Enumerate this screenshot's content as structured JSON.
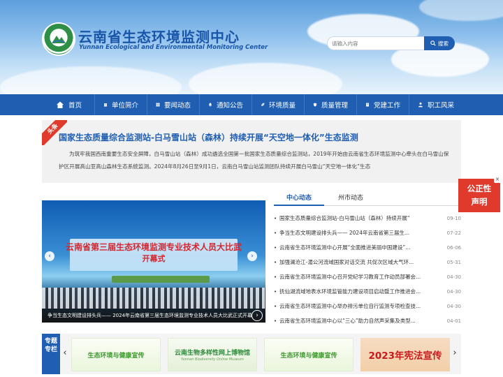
{
  "header": {
    "site_title": "云南省生态环境监测中心",
    "site_subtitle": "Yunnan Ecological and Environmental Monitoring Center",
    "logo_icon": "emblem-icon",
    "search": {
      "placeholder": "请输入内容",
      "button_label": "搜索",
      "button_icon": "search-icon"
    }
  },
  "nav": {
    "items": [
      {
        "label": "首页",
        "icon": "home-icon"
      },
      {
        "label": "单位简介",
        "icon": "building-icon"
      },
      {
        "label": "要闻动态",
        "icon": "grid-icon"
      },
      {
        "label": "通知公告",
        "icon": "bell-icon"
      },
      {
        "label": "环境质量",
        "icon": "leaf-icon"
      },
      {
        "label": "质量管理",
        "icon": "shield-icon"
      },
      {
        "label": "党建工作",
        "icon": "book-icon"
      },
      {
        "label": "职工风采",
        "icon": "people-icon"
      }
    ]
  },
  "headline": {
    "ribbon": "头条",
    "title": "国家生态质量综合监测站-白马雪山站（森林）持续开展“天空地一体化”生态监测",
    "summary": "为筑牢我国西南重要生态安全屏障，白马雪山站（森林）成功遴选全国第一批国家生态质量综合监测站，2019年开始由云南省生态环境监测中心牵头在白马雪山保护区开展高山亚高山森林生态系统监测。2024年8月26日至9月1日，云南白马雪山站监测团队持续开展白马雪山“天空地一体化”生态"
  },
  "slider": {
    "stage_title": "云南省第三届生态环境监测专业技术人员大比武",
    "stage_subtitle": "开幕式",
    "caption": "争当生态文明建设排头兵—— 2024年云南省第三届生态环境监测专业技术人员大比武正式开幕",
    "prev_icon": "chevron-left-icon",
    "next_icon": "chevron-right-icon",
    "play_icon": "play-icon"
  },
  "news": {
    "tabs": [
      "中心动态",
      "州市动态"
    ],
    "active_tab": "中心动态",
    "items": [
      {
        "title": "国家生态质量综合监测站-白马雪山站（森林）持续开展“",
        "date": "09-10"
      },
      {
        "title": "争当生态文明建设排头兵—— 2024年云南省第三届生...",
        "date": "07-22"
      },
      {
        "title": "云南省生态环境监测中心开展“全面推进美丽中国建设”...",
        "date": "06-06"
      },
      {
        "title": "加强澜沧江-湄公河流域国家对话交流 共促次区域大气环...",
        "date": "05-31"
      },
      {
        "title": "云南省生态环境监测中心召开党纪学习教育工作动员部署会...",
        "date": "04-30"
      },
      {
        "title": "抚仙湖流域地表水环境监管能力建设项目启动暨工作推进会...",
        "date": "04-30"
      },
      {
        "title": "云南省生态环境监测中心举办排污单位自行监测专项检查技...",
        "date": "04-30"
      },
      {
        "title": "云南省生态环境监测中心以“三心”助力自然声采集及类型...",
        "date": "04-01"
      }
    ]
  },
  "float_badge": {
    "line1": "公正性",
    "line2": "声明",
    "close_icon": "close-icon",
    "close_label": "×"
  },
  "feature": {
    "tag": "专题专栏",
    "prev_icon": "chevron-left-icon",
    "next_icon": "chevron-right-icon",
    "banners": [
      {
        "title": "生态环境与健康宣传"
      },
      {
        "title": "云南生物多样性网上博物馆",
        "subtitle": "Yunnan Biodiversity Online Museum"
      },
      {
        "title": "生态环境与健康宣传"
      },
      {
        "title": "2023年宪法宣传"
      }
    ]
  },
  "colors": {
    "brand_blue": "#1f5eb1",
    "accent_red": "#e03a2c",
    "stage_red": "#d4262f"
  }
}
